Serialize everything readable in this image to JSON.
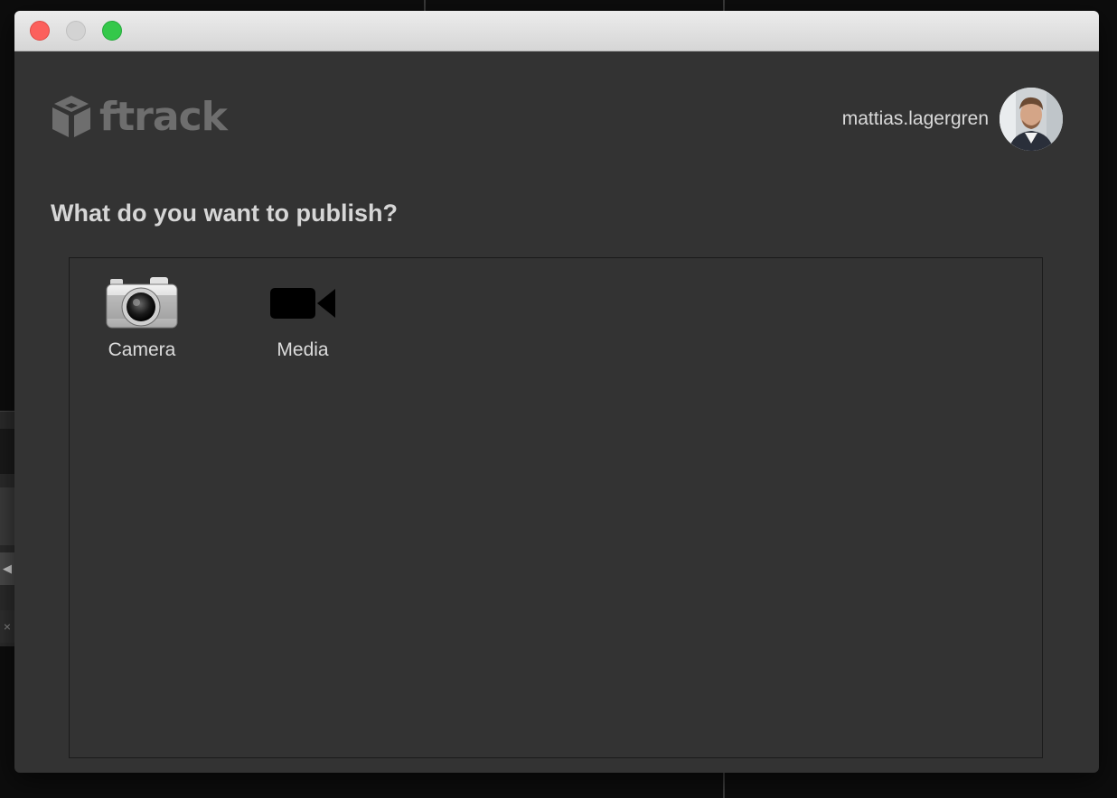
{
  "brand": {
    "name": "ftrack"
  },
  "user": {
    "name": "mattias.lagergren"
  },
  "prompt": {
    "title": "What do you want to publish?"
  },
  "publish_options": [
    {
      "label": "Camera",
      "icon": "camera-icon"
    },
    {
      "label": "Media",
      "icon": "video-camera-icon"
    }
  ],
  "background": {
    "left_x_label": "×"
  },
  "colors": {
    "window_bg": "#333333",
    "title_text": "#d6d6d6",
    "close": "#fc605c",
    "minimize": "#d3d3d3",
    "maximize": "#34c84a"
  }
}
